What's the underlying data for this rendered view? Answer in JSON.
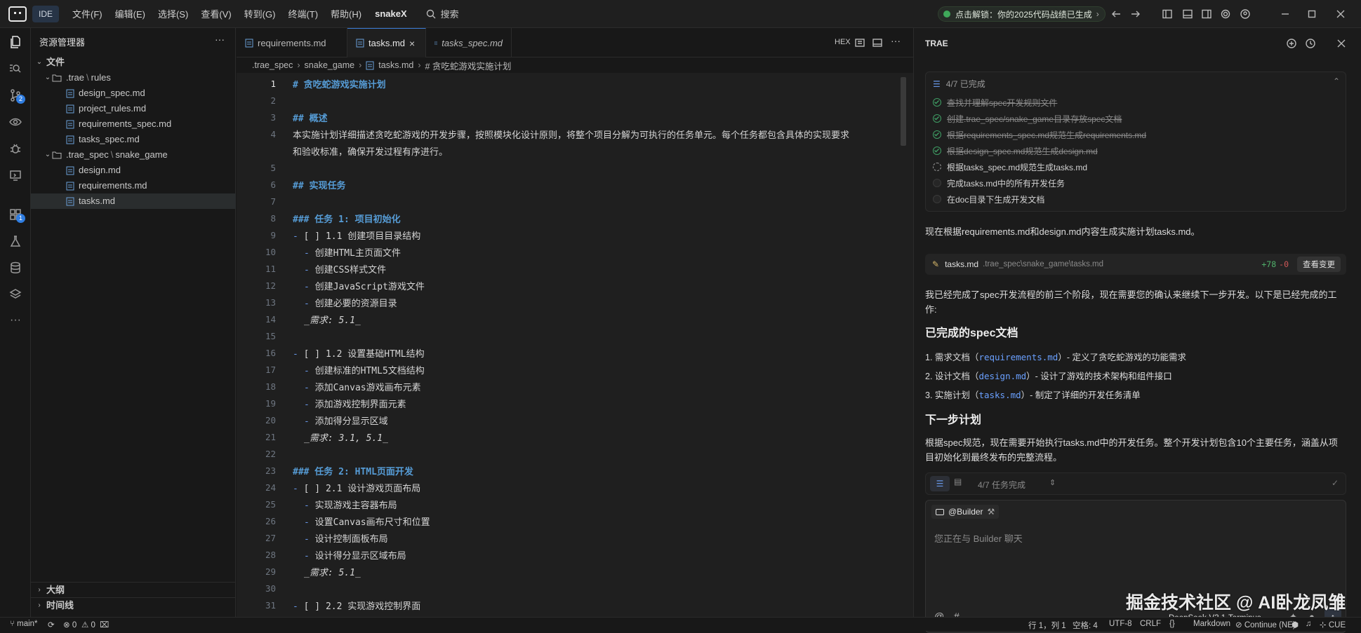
{
  "titlebar": {
    "ide_badge": "IDE",
    "menu": [
      "文件(F)",
      "编辑(E)",
      "选择(S)",
      "查看(V)",
      "转到(G)",
      "终端(T)",
      "帮助(H)"
    ],
    "project": "snakeX",
    "search": "搜索",
    "promo": "点击解锁：你的2025代码战绩已生成"
  },
  "sidebar": {
    "title": "资源管理器",
    "root": "文件",
    "items": [
      {
        "label": ".trae",
        "sub": "rules",
        "kind": "folder"
      },
      {
        "label": "design_spec.md",
        "kind": "file"
      },
      {
        "label": "project_rules.md",
        "kind": "file"
      },
      {
        "label": "requirements_spec.md",
        "kind": "file"
      },
      {
        "label": "tasks_spec.md",
        "kind": "file"
      },
      {
        "label": ".trae_spec",
        "sub": "snake_game",
        "kind": "folder"
      },
      {
        "label": "design.md",
        "kind": "file"
      },
      {
        "label": "requirements.md",
        "kind": "file"
      },
      {
        "label": "tasks.md",
        "kind": "file",
        "selected": true
      }
    ],
    "outline": "大纲",
    "timeline": "时间线",
    "scm_badge": "2",
    "ext_badge": "1"
  },
  "tabs": [
    {
      "label": "requirements.md"
    },
    {
      "label": "tasks.md",
      "active": true,
      "close": "×"
    },
    {
      "label": "tasks_spec.md",
      "italic": true
    }
  ],
  "editor_actions": {
    "hex": "HEX"
  },
  "breadcrumb": [
    ".trae_spec",
    "snake_game",
    "tasks.md",
    "# 贪吃蛇游戏实施计划"
  ],
  "code_lines": [
    {
      "n": "1",
      "t": "# 贪吃蛇游戏实施计划",
      "k": "h"
    },
    {
      "n": "2",
      "t": "",
      "k": ""
    },
    {
      "n": "3",
      "t": "## 概述",
      "k": "h"
    },
    {
      "n": "4",
      "t": "本实施计划详细描述贪吃蛇游戏的开发步骤，按照模块化设计原则，将整个项目分解为可执行的任务单元。每个任务都包含具体的实现要求",
      "k": "p"
    },
    {
      "n": "",
      "t": "和验收标准，确保开发过程有序进行。",
      "k": "p"
    },
    {
      "n": "5",
      "t": "",
      "k": ""
    },
    {
      "n": "6",
      "t": "## 实现任务",
      "k": "h"
    },
    {
      "n": "7",
      "t": "",
      "k": ""
    },
    {
      "n": "8",
      "t": "### 任务 1: 项目初始化",
      "k": "h"
    },
    {
      "n": "9",
      "t": "[ ] 1.1 创建项目目录结构",
      "k": "task"
    },
    {
      "n": "10",
      "t": "创建HTML主页面文件",
      "k": "sub"
    },
    {
      "n": "11",
      "t": "创建CSS样式文件",
      "k": "sub"
    },
    {
      "n": "12",
      "t": "创建JavaScript游戏文件",
      "k": "sub"
    },
    {
      "n": "13",
      "t": "创建必要的资源目录",
      "k": "sub"
    },
    {
      "n": "14",
      "t": "_需求: 5.1_",
      "k": "req"
    },
    {
      "n": "15",
      "t": "",
      "k": ""
    },
    {
      "n": "16",
      "t": "[ ] 1.2 设置基础HTML结构",
      "k": "task"
    },
    {
      "n": "17",
      "t": "创建标准的HTML5文档结构",
      "k": "sub"
    },
    {
      "n": "18",
      "t": "添加Canvas游戏画布元素",
      "k": "sub"
    },
    {
      "n": "19",
      "t": "添加游戏控制界面元素",
      "k": "sub"
    },
    {
      "n": "20",
      "t": "添加得分显示区域",
      "k": "sub"
    },
    {
      "n": "21",
      "t": "_需求: 3.1, 5.1_",
      "k": "req"
    },
    {
      "n": "22",
      "t": "",
      "k": ""
    },
    {
      "n": "23",
      "t": "### 任务 2: HTML页面开发",
      "k": "h"
    },
    {
      "n": "24",
      "t": "[ ] 2.1 设计游戏页面布局",
      "k": "task"
    },
    {
      "n": "25",
      "t": "实现游戏主容器布局",
      "k": "sub"
    },
    {
      "n": "26",
      "t": "设置Canvas画布尺寸和位置",
      "k": "sub"
    },
    {
      "n": "27",
      "t": "设计控制面板布局",
      "k": "sub"
    },
    {
      "n": "28",
      "t": "设计得分显示区域布局",
      "k": "sub"
    },
    {
      "n": "29",
      "t": "_需求: 5.1_",
      "k": "req"
    },
    {
      "n": "30",
      "t": "",
      "k": ""
    },
    {
      "n": "31",
      "t": "[ ] 2.2 实现游戏控制界面",
      "k": "task"
    }
  ],
  "panel": {
    "title": "TRAE",
    "progress": "4/7 已完成",
    "tasks": [
      {
        "label": "查找并理解spec开发规则文件",
        "state": "done"
      },
      {
        "label": "创建.trae_spec/snake_game目录存放spec文档",
        "state": "done"
      },
      {
        "label": "根据requirements_spec.md规范生成requirements.md",
        "state": "done"
      },
      {
        "label": "根据design_spec.md规范生成design.md",
        "state": "done"
      },
      {
        "label": "根据tasks_spec.md规范生成tasks.md",
        "state": "pending"
      },
      {
        "label": "完成tasks.md中的所有开发任务",
        "state": "todo"
      },
      {
        "label": "在doc目录下生成开发文档",
        "state": "todo"
      }
    ],
    "msg1": "现在根据requirements.md和design.md内容生成实施计划tasks.md。",
    "file_card": {
      "name": "tasks.md",
      "path": ".trae_spec\\snake_game\\tasks.md",
      "added": "+78",
      "removed": "-0",
      "button": "查看变更"
    },
    "msg2": "我已经完成了spec开发流程的前三个阶段，现在需要您的确认来继续下一步开发。以下是已经完成的工",
    "msg2b": "作:",
    "h_done": "已完成的spec文档",
    "docs": [
      {
        "num": "1.",
        "pre": "需求文档（",
        "code": "requirements.md",
        "post": "）- 定义了贪吃蛇游戏的功能需求"
      },
      {
        "num": "2.",
        "pre": "设计文档（",
        "code": "design.md",
        "post": "）- 设计了游戏的技术架构和组件接口"
      },
      {
        "num": "3.",
        "pre": "实施计划（",
        "code": "tasks.md",
        "post": "）- 制定了详细的开发任务清单"
      }
    ],
    "h_next": "下一步计划",
    "next1": "根据spec规范，现在需要开始执行tasks.md中的开发任务。整个开发计划包含10个主要任务，涵盖从项",
    "next2": "目初始化到最终发布的完整流程。",
    "status_pill": "4/7 任务完成",
    "agent": "@Builder",
    "placeholder": "您正在与 Builder 聊天",
    "model": "DeepSeek-V3.1-Terminus"
  },
  "statusbar": {
    "branch": "main*",
    "errors": "0",
    "warnings": "0",
    "position": "行 1，列 1",
    "spaces": "空格: 4",
    "encoding": "UTF-8",
    "eol": "CRLF",
    "braces": "{}",
    "lang": "Markdown",
    "cont": "Continue (NE)",
    "cue": "CUE"
  },
  "watermark": "掘金技术社区 @ AI卧龙凤雏"
}
